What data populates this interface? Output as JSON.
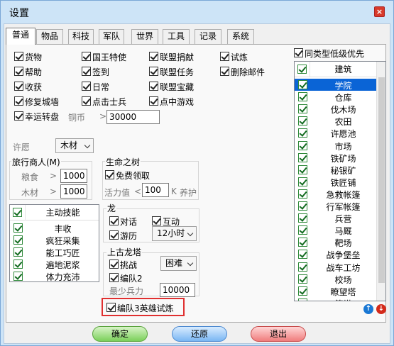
{
  "window": {
    "title": "设置",
    "close_glyph": "×"
  },
  "tabs": [
    "普通",
    "物品",
    "科技",
    "军队",
    "世界",
    "工具",
    "记录",
    "系统"
  ],
  "options": {
    "col1": [
      "货物",
      "帮助",
      "收获",
      "修复城墙",
      "幸运转盘"
    ],
    "col2": [
      "国王特使",
      "签到",
      "日常",
      "点击士兵"
    ],
    "col3": [
      "联盟捐献",
      "联盟任务",
      "联盟宝藏",
      "点中游戏"
    ],
    "col4": [
      "试炼",
      "删除邮件"
    ]
  },
  "copper": {
    "label": "铜币",
    "op": ">",
    "value": "30000"
  },
  "wish": {
    "label": "许愿",
    "value": "木材"
  },
  "merchant": {
    "title": "旅行商人(M)",
    "food_label": "粮食",
    "food_op": ">",
    "food_value": "1000",
    "wood_label": "木材",
    "wood_op": ">",
    "wood_value": "1000"
  },
  "tree": {
    "title": "生命之树",
    "free_label": "免费领取",
    "energy_label": "活力值",
    "energy_op": "<",
    "energy_value": "100",
    "energy_unit": "K",
    "maintain_label": "养护"
  },
  "skills": {
    "header": "主动技能",
    "items": [
      "丰收",
      "疯狂采集",
      "能工巧匠",
      "遍地泥浆",
      "体力充沛"
    ]
  },
  "dragon": {
    "title": "龙",
    "talk_label": "对话",
    "interact_label": "互动",
    "play_label": "游历",
    "play_value": "12小时"
  },
  "tower": {
    "title": "上古龙塔",
    "challenge_label": "挑战",
    "difficulty": "困难",
    "team2_label": "编队2",
    "min_troops_label": "最少兵力",
    "min_troops_value": "10000"
  },
  "hero_trial": {
    "label": "编队3英雄试炼",
    "highlight_color": "#e03030"
  },
  "buildings": {
    "same_type_label": "同类型低级优先",
    "header": "建筑",
    "items": [
      "学院",
      "仓库",
      "伐木场",
      "农田",
      "许愿池",
      "市场",
      "铁矿场",
      "秘银矿",
      "铁匠铺",
      "急救帐篷",
      "行军帐篷",
      "兵营",
      "马厩",
      "靶场",
      "战争堡垒",
      "战车工坊",
      "校场",
      "瞭望塔",
      "箭塔"
    ],
    "selected": "学院"
  },
  "buttons": {
    "ok": "确定",
    "restore": "还原",
    "exit": "退出"
  },
  "colors": {
    "accent": "#0a64d6",
    "highlight": "#e03030"
  }
}
